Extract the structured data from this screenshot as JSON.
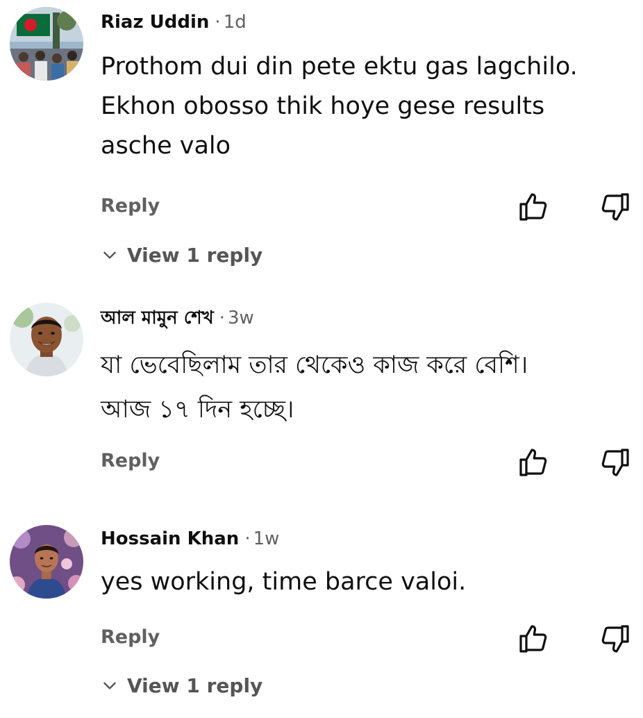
{
  "comments": [
    {
      "author": "Riaz Uddin",
      "separator": "·",
      "age": "1d",
      "text_lines": [
        "Prothom dui din pete ektu gas lagchilo.",
        "Ekhon obosso thik hoye gese results",
        "asche valo"
      ],
      "reply_label": "Reply",
      "view_replies_label": "View 1 reply",
      "avatar": "flag-crowd-photo"
    },
    {
      "author": "আল মামুন শেখ",
      "separator": "·",
      "age": "3w",
      "text_lines": [
        "যা ভেবেছিলাম তার থেকেও কাজ করে বেশি।",
        "আজ ১৭ দিন হচ্ছে।"
      ],
      "reply_label": "Reply",
      "avatar": "smiling-man-photo"
    },
    {
      "author": "Hossain Khan",
      "separator": "·",
      "age": "1w",
      "text_lines": [
        "yes working, time barce valoi."
      ],
      "reply_label": "Reply",
      "view_replies_label": "View 1 reply",
      "avatar": "man-with-flowers-photo"
    }
  ],
  "icons": {
    "like": "thumbs-up-icon",
    "dislike": "thumbs-down-icon",
    "expand": "chevron-down-icon"
  },
  "colors": {
    "text": "#0f0f0f",
    "secondary": "#606060"
  }
}
